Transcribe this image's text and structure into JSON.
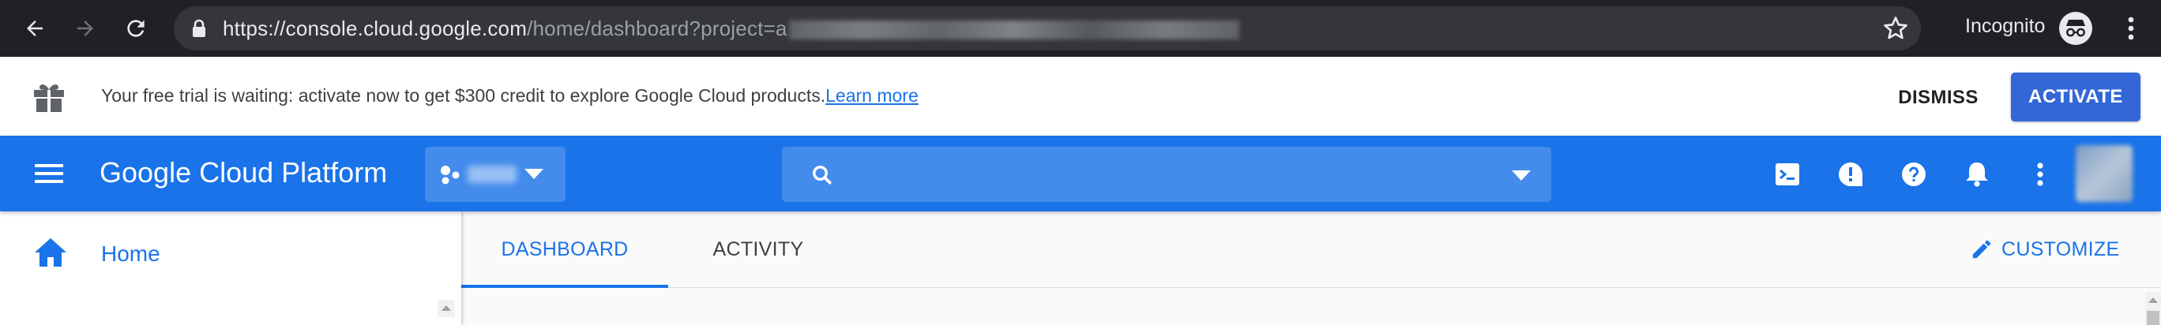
{
  "browser": {
    "url_host": "https://console.cloud.google.com",
    "url_path": "/home/dashboard?project=a",
    "incognito_label": "Incognito"
  },
  "banner": {
    "message": "Your free trial is waiting: activate now to get $300 credit to explore Google Cloud products.",
    "link_text": "Learn more",
    "dismiss_label": "DISMISS",
    "activate_label": "ACTIVATE"
  },
  "header": {
    "title": "Google Cloud Platform",
    "search_placeholder": ""
  },
  "nav": {
    "home_label": "Home"
  },
  "tabs": [
    {
      "label": "DASHBOARD",
      "active": true
    },
    {
      "label": "ACTIVITY",
      "active": false
    }
  ],
  "customize_label": "CUSTOMIZE",
  "colors": {
    "brand_blue": "#1a73e8",
    "activate_blue": "#3367d6",
    "chrome_dark": "#202124"
  },
  "icons": [
    "back-icon",
    "forward-icon",
    "reload-icon",
    "lock-icon",
    "star-icon",
    "incognito-icon",
    "gift-icon",
    "menu-icon",
    "project-dots-icon",
    "search-icon",
    "cloud-shell-icon",
    "feedback-icon",
    "help-icon",
    "notifications-icon",
    "more-vert-icon",
    "home-icon",
    "pencil-icon"
  ]
}
